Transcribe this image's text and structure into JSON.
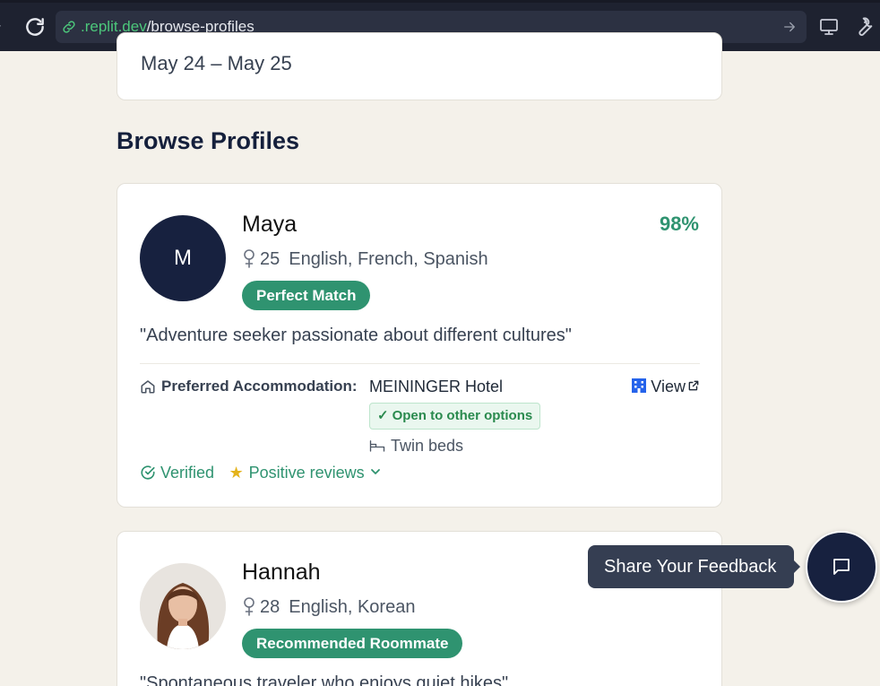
{
  "browser": {
    "url_host": ".replit.dev",
    "url_path": "/browse-profiles"
  },
  "trip": {
    "dates": "May 24 – May 25"
  },
  "section_title": "Browse Profiles",
  "profiles": [
    {
      "initial": "M",
      "name": "Maya",
      "age": "25",
      "languages": "English, French, Spanish",
      "badge": "Perfect Match",
      "match": "98%",
      "quote": "\"Adventure seeker passionate about different cultures\"",
      "accommodation_label": "Preferred Accommodation:",
      "hotel": "MEININGER Hotel",
      "view_label": "View",
      "open_tag": "Open to other options",
      "beds": "Twin beds",
      "verified": "Verified",
      "reviews": "Positive reviews"
    },
    {
      "name": "Hannah",
      "age": "28",
      "languages": "English, Korean",
      "badge": "Recommended Roommate",
      "quote": "\"Spontaneous traveler who enjoys quiet hikes\""
    }
  ],
  "feedback": {
    "label": "Share Your Feedback"
  },
  "colors": {
    "accent": "#2f9370",
    "navy": "#17213f",
    "background": "#f4f1ea"
  }
}
